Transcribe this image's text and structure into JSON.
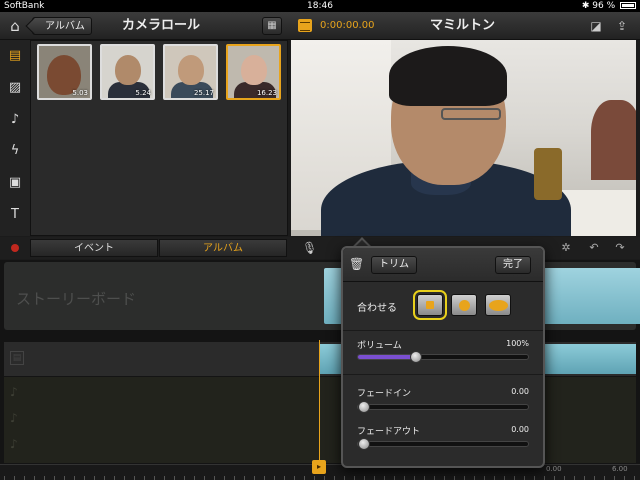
{
  "status": {
    "carrier": "SoftBank",
    "time": "18:46",
    "battery": "96 %"
  },
  "toolbar": {
    "back_label": "アルバム",
    "library_title": "カメラロール",
    "timecode": "0:00:00.00",
    "project_title": "マミルトン"
  },
  "library": {
    "clips": [
      {
        "duration": "5.03",
        "selected": false
      },
      {
        "duration": "5.24",
        "selected": false
      },
      {
        "duration": "25.17",
        "selected": false
      },
      {
        "duration": "16.23",
        "selected": true
      }
    ]
  },
  "modes": {
    "event_tab": "イベント",
    "album_tab": "アルバム",
    "active": "album"
  },
  "timeline": {
    "storyboard_placeholder": "ストーリーボード",
    "ruler_start": "6.00",
    "ruler_end": "0.00"
  },
  "trim_popover": {
    "trim_button": "トリム",
    "done_button": "完了",
    "fit_label": "合わせる",
    "fit_selected": "first",
    "volume_label": "ボリューム",
    "volume_value": "100%",
    "volume_fraction": 0.34,
    "fade_in_label": "フェードイン",
    "fade_in_value": "0.00",
    "fade_in_fraction": 0.0,
    "fade_out_label": "フェードアウト",
    "fade_out_value": "0.00",
    "fade_out_fraction": 0.0
  },
  "colors": {
    "accent": "#e8a41c",
    "volume_fill": "#7a4fd0",
    "record": "#c0281e"
  },
  "icons": [
    "home-icon",
    "grid-icon",
    "film-icon",
    "enhance-icon",
    "share-icon",
    "projects-icon",
    "photos-icon",
    "music-icon",
    "transitions-icon",
    "titles-icon",
    "text-icon",
    "mic-icon",
    "settings-icon",
    "undo-icon",
    "redo-icon",
    "trash-icon"
  ]
}
